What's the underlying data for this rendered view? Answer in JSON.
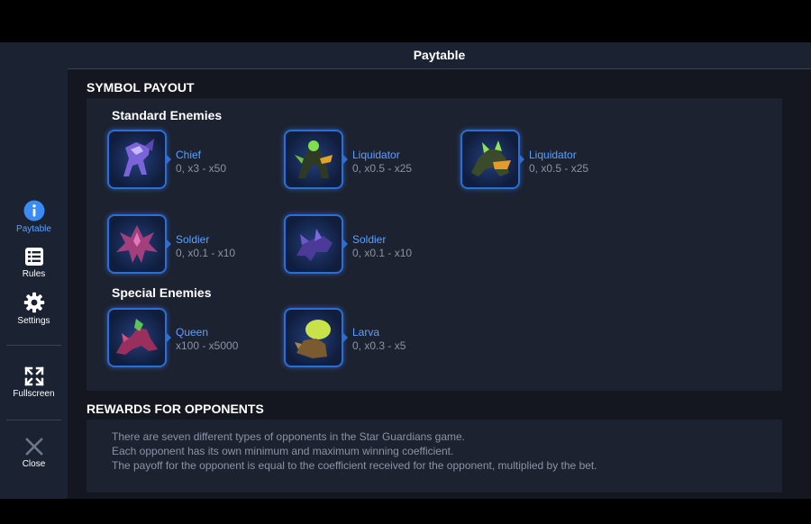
{
  "header": {
    "title": "Paytable"
  },
  "sidebar": {
    "items": [
      {
        "label": "Paytable"
      },
      {
        "label": "Rules"
      },
      {
        "label": "Settings"
      },
      {
        "label": "Fullscreen"
      },
      {
        "label": "Close"
      }
    ]
  },
  "symbol_payout": {
    "title": "SYMBOL PAYOUT",
    "standard_title": "Standard Enemies",
    "special_title": "Special Enemies",
    "standard": [
      {
        "name": "Chief",
        "value": "0, x3 - x50"
      },
      {
        "name": "Liquidator",
        "value": "0, x0.5 - x25"
      },
      {
        "name": "Liquidator",
        "value": "0, x0.5 - x25"
      },
      {
        "name": "Soldier",
        "value": "0, x0.1 - x10"
      },
      {
        "name": "Soldier",
        "value": "0, x0.1 - x10"
      }
    ],
    "special": [
      {
        "name": "Queen",
        "value": "x100 - x5000"
      },
      {
        "name": "Larva",
        "value": "0, x0.3 - x5"
      }
    ]
  },
  "rewards": {
    "title": "REWARDS FOR OPPONENTS",
    "lines": [
      "There are seven different types of opponents in the Star Guardians game.",
      "Each opponent has its own minimum and maximum winning coefficient.",
      "The payoff for the opponent is equal to the coefficient received for the opponent, multiplied by the bet."
    ]
  },
  "colors": {
    "accent": "#5aa0ff",
    "background": "#141720",
    "panel": "#1d2230",
    "sidebar": "#1b2231",
    "muted_text": "#8a93a6"
  },
  "icons": [
    "info-icon",
    "list-icon",
    "gear-icon",
    "expand-icon",
    "close-icon"
  ]
}
